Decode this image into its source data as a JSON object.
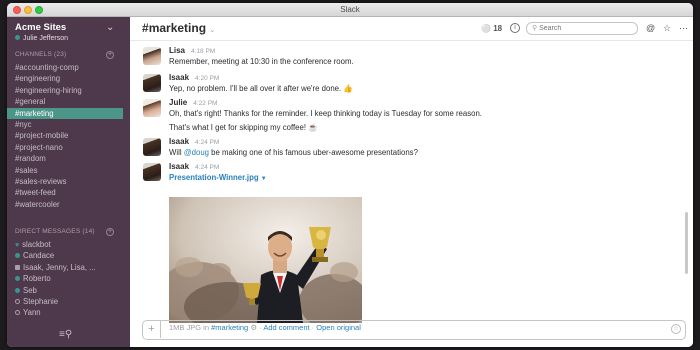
{
  "window": {
    "title": "Slack"
  },
  "sidebar": {
    "team_name": "Acme Sites",
    "user_name": "Julie Jefferson",
    "channels_heading": "CHANNELS",
    "channels_count": "(23)",
    "channels": [
      {
        "label": "accounting-comp"
      },
      {
        "label": "engineering"
      },
      {
        "label": "engineering-hiring"
      },
      {
        "label": "general"
      },
      {
        "label": "marketing",
        "active": true
      },
      {
        "label": "nyc"
      },
      {
        "label": "project-mobile"
      },
      {
        "label": "project-nano"
      },
      {
        "label": "random"
      },
      {
        "label": "sales"
      },
      {
        "label": "sales-reviews"
      },
      {
        "label": "tweet-feed"
      },
      {
        "label": "watercooler"
      }
    ],
    "dm_heading": "DIRECT MESSAGES",
    "dm_count": "(14)",
    "dms": [
      {
        "label": "slackbot",
        "status": "heart"
      },
      {
        "label": "Candace",
        "status": "online"
      },
      {
        "label": "Isaak, Jenny, Lisa, ...",
        "status": "group"
      },
      {
        "label": "Roberto",
        "status": "online"
      },
      {
        "label": "Seb",
        "status": "online"
      },
      {
        "label": "Stephanie",
        "status": "offline"
      },
      {
        "label": "Yann",
        "status": "offline"
      }
    ],
    "colors": {
      "background": "#4d394b",
      "active": "#4c9689",
      "presence": "#38978d"
    }
  },
  "header": {
    "channel_name": "marketing",
    "member_count": "18",
    "search_placeholder": "Search"
  },
  "messages": [
    {
      "author": "Lisa",
      "time": "4:18 PM",
      "text": "Remember, meeting at 10:30 in the conference room.",
      "avatar": "lisa"
    },
    {
      "author": "Isaak",
      "time": "4:20 PM",
      "text": "Yep, no problem. I'll be all over it after we're done. 👍",
      "avatar": "isaak"
    },
    {
      "author": "Julie",
      "time": "4:22 PM",
      "text": "Oh, that's right! Thanks for the reminder. I keep thinking today is Tuesday for some reason.",
      "text2": "That's what I get for skipping my coffee! ☕",
      "avatar": "julie"
    },
    {
      "author": "Isaak",
      "time": "4:24 PM",
      "text_before": "Will ",
      "mention": "@doug",
      "text_after": " be making one of his famous uber-awesome presentations?",
      "avatar": "isaak"
    },
    {
      "author": "Isaak",
      "time": "4:24 PM",
      "file_name": "Presentation-Winner.jpg",
      "file_meta": "1MB JPG in ",
      "file_channel": "#marketing",
      "add_comment": "Add comment",
      "open_original": "Open original",
      "avatar": "isaak"
    }
  ],
  "icons": [
    "chevron-down-icon",
    "plus-circle-icon",
    "member-icon",
    "info-icon",
    "search-icon",
    "mention-icon",
    "star-icon",
    "more-icon",
    "filter-search-icon",
    "emoji-icon"
  ]
}
